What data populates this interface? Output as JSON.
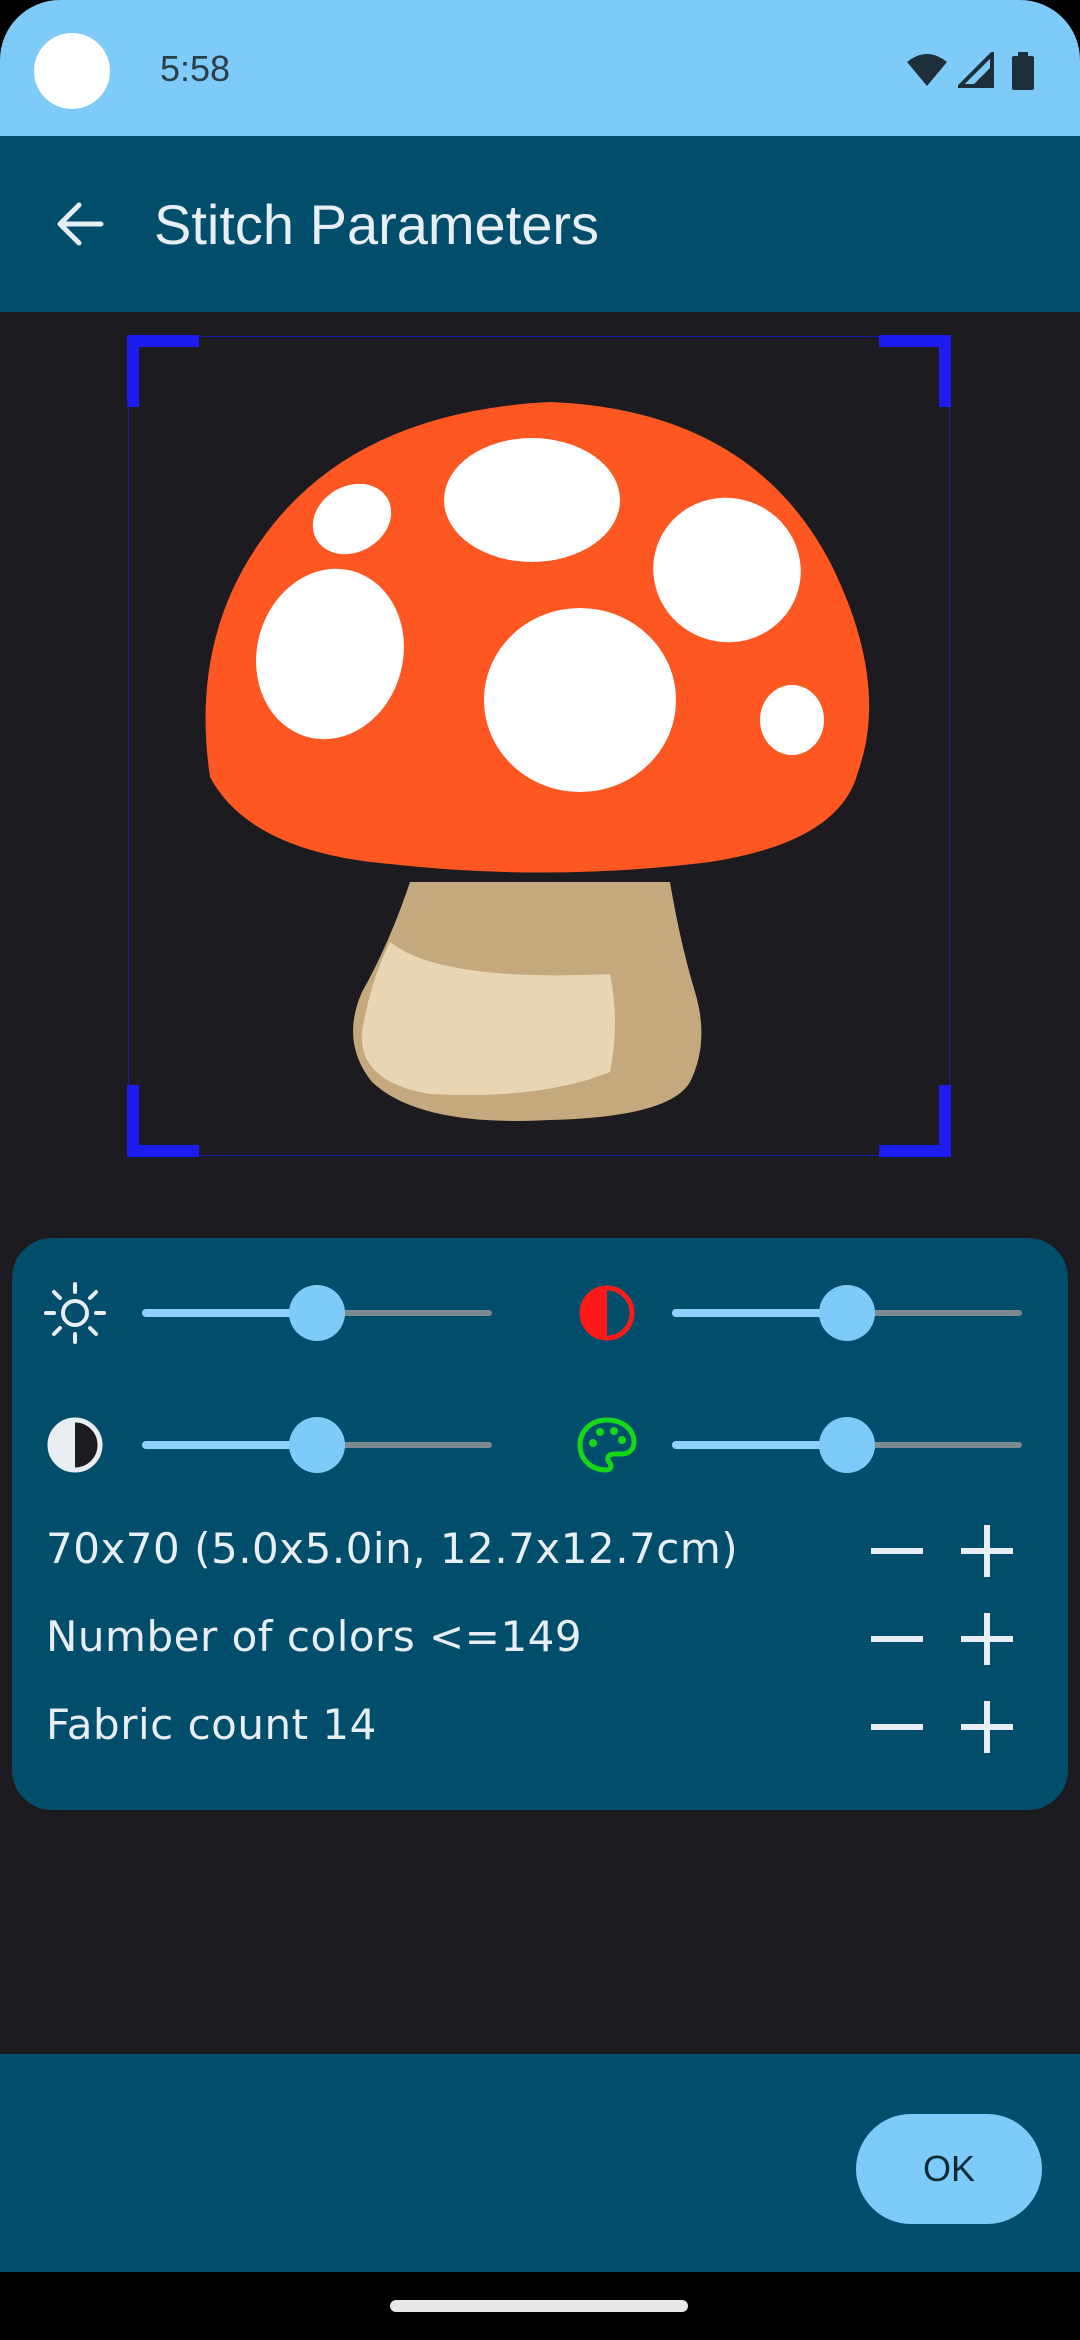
{
  "status_bar": {
    "time": "5:58"
  },
  "app_bar": {
    "title": "Stitch Parameters"
  },
  "controls": {
    "brightness": {
      "icon": "brightness-icon",
      "value": 0.5
    },
    "contrast_red": {
      "icon": "contrast-red-icon",
      "value": 0.5
    },
    "contrast": {
      "icon": "contrast-icon",
      "value": 0.5
    },
    "palette": {
      "icon": "palette-icon",
      "value": 0.5
    }
  },
  "params": {
    "size": {
      "label": "70x70 (5.0x5.0in, 12.7x12.7cm)"
    },
    "colors": {
      "label": "Number of colors <=149"
    },
    "fabric": {
      "label": "Fabric count 14"
    }
  },
  "actions": {
    "ok_label": "OK"
  },
  "colors": {
    "status_bar": "#7ecbfa",
    "app_bar": "#004e6c",
    "accent": "#7ecbfa",
    "background": "#1c1b1f",
    "crop_frame": "#1c1cf0"
  }
}
